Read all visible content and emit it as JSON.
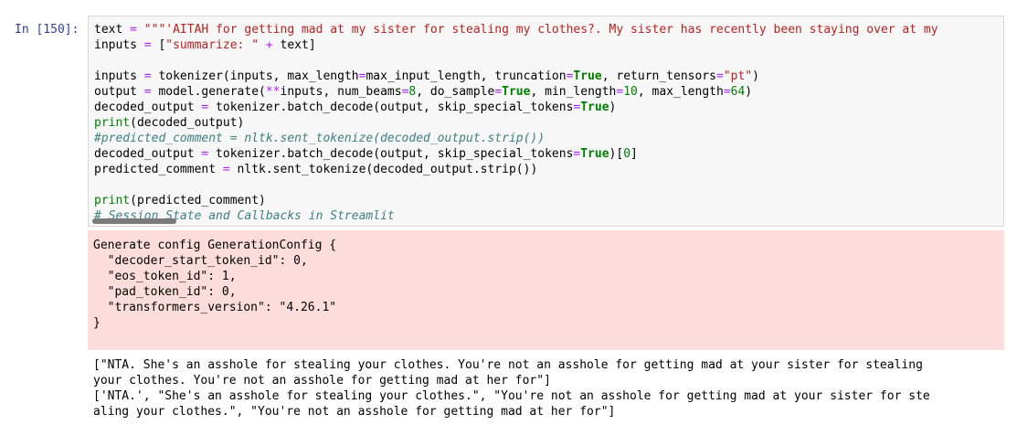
{
  "cell": {
    "prompt": "In [150]:",
    "lines": [
      [
        {
          "t": "text "
        },
        {
          "t": "=",
          "c": "op"
        },
        {
          "t": " "
        },
        {
          "t": "\"\"\"'AITAH for getting mad at my sister for stealing my clothes?. My sister has recently been staying over at my",
          "c": "str"
        }
      ],
      [
        {
          "t": "inputs "
        },
        {
          "t": "=",
          "c": "op"
        },
        {
          "t": " ["
        },
        {
          "t": "\"summarize: \"",
          "c": "str"
        },
        {
          "t": " "
        },
        {
          "t": "+",
          "c": "op"
        },
        {
          "t": " text]"
        }
      ],
      [],
      [
        {
          "t": "inputs "
        },
        {
          "t": "=",
          "c": "op"
        },
        {
          "t": " tokenizer(inputs, max_length"
        },
        {
          "t": "=",
          "c": "op"
        },
        {
          "t": "max_input_length, truncation"
        },
        {
          "t": "=",
          "c": "op"
        },
        {
          "t": "True",
          "c": "kw"
        },
        {
          "t": ", return_tensors"
        },
        {
          "t": "=",
          "c": "op"
        },
        {
          "t": "\"pt\"",
          "c": "str"
        },
        {
          "t": ")"
        }
      ],
      [
        {
          "t": "output "
        },
        {
          "t": "=",
          "c": "op"
        },
        {
          "t": " model.generate("
        },
        {
          "t": "**",
          "c": "op"
        },
        {
          "t": "inputs, num_beams"
        },
        {
          "t": "=",
          "c": "op"
        },
        {
          "t": "8",
          "c": "num"
        },
        {
          "t": ", do_sample"
        },
        {
          "t": "=",
          "c": "op"
        },
        {
          "t": "True",
          "c": "kw"
        },
        {
          "t": ", min_length"
        },
        {
          "t": "=",
          "c": "op"
        },
        {
          "t": "10",
          "c": "num"
        },
        {
          "t": ", max_length"
        },
        {
          "t": "=",
          "c": "op"
        },
        {
          "t": "64",
          "c": "num"
        },
        {
          "t": ")"
        }
      ],
      [
        {
          "t": "decoded_output "
        },
        {
          "t": "=",
          "c": "op"
        },
        {
          "t": " tokenizer.batch_decode(output, skip_special_tokens"
        },
        {
          "t": "=",
          "c": "op"
        },
        {
          "t": "True",
          "c": "kw"
        },
        {
          "t": ")"
        }
      ],
      [
        {
          "t": "print",
          "c": "fn"
        },
        {
          "t": "(decoded_output)"
        }
      ],
      [
        {
          "t": "#predicted_comment = nltk.sent_tokenize(decoded_output.strip())",
          "c": "cm"
        }
      ],
      [
        {
          "t": "decoded_output "
        },
        {
          "t": "=",
          "c": "op"
        },
        {
          "t": " tokenizer.batch_decode(output, skip_special_tokens"
        },
        {
          "t": "=",
          "c": "op"
        },
        {
          "t": "True",
          "c": "kw"
        },
        {
          "t": ")["
        },
        {
          "t": "0",
          "c": "num"
        },
        {
          "t": "]"
        }
      ],
      [
        {
          "t": "predicted_comment "
        },
        {
          "t": "=",
          "c": "op"
        },
        {
          "t": " nltk.sent_tokenize(decoded_output.strip())"
        }
      ],
      [],
      [
        {
          "t": "print",
          "c": "fn"
        },
        {
          "t": "(predicted_comment)"
        }
      ],
      [
        {
          "t": "# Session State and Callbacks in Streamlit",
          "c": "cm"
        }
      ]
    ]
  },
  "stderr": {
    "lines": [
      "Generate config GenerationConfig {",
      "  \"decoder_start_token_id\": 0,",
      "  \"eos_token_id\": 1,",
      "  \"pad_token_id\": 0,",
      "  \"transformers_version\": \"4.26.1\"",
      "}"
    ]
  },
  "stdout": {
    "lines": [
      "[\"NTA. She's an asshole for stealing your clothes. You're not an asshole for getting mad at your sister for stealing",
      "your clothes. You're not an asshole for getting mad at her for\"]",
      "['NTA.', \"She's an asshole for stealing your clothes.\", \"You're not an asshole for getting mad at your sister for ste",
      "aling your clothes.\", \"You're not an asshole for getting mad at her for\"]"
    ]
  }
}
